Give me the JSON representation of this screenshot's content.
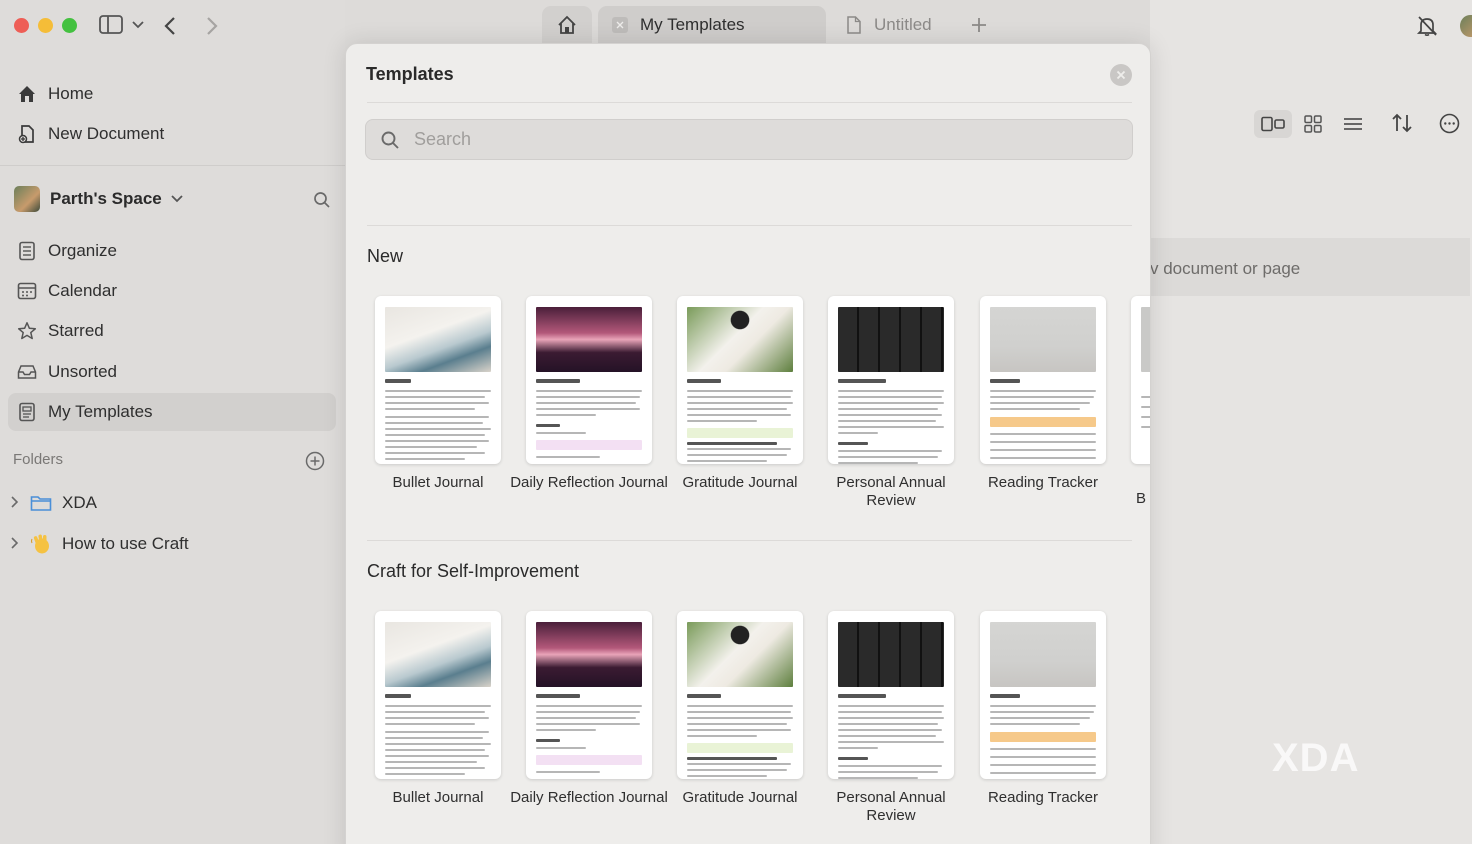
{
  "sidebar": {
    "nav": [
      {
        "label": "Home",
        "icon": "home-icon"
      },
      {
        "label": "New Document",
        "icon": "new-document-icon"
      }
    ],
    "space_name": "Parth's Space",
    "items": [
      {
        "label": "Organize",
        "icon": "organize-icon"
      },
      {
        "label": "Calendar",
        "icon": "calendar-icon"
      },
      {
        "label": "Starred",
        "icon": "star-icon"
      },
      {
        "label": "Unsorted",
        "icon": "inbox-icon"
      },
      {
        "label": "My Templates",
        "icon": "templates-icon"
      }
    ],
    "folders_label": "Folders",
    "folders": [
      {
        "label": "XDA",
        "icon": "folder-icon"
      },
      {
        "label": "How to use Craft",
        "icon": "waving-hand-icon"
      }
    ]
  },
  "tabs": {
    "active": "My Templates",
    "inactive": "Untitled"
  },
  "right": {
    "hint": "v document or page"
  },
  "modal": {
    "title": "Templates",
    "search_placeholder": "Search",
    "sections": [
      {
        "title": "New",
        "cards": [
          {
            "label": "Bullet Journal"
          },
          {
            "label": "Daily Reflection Journal"
          },
          {
            "label": "Gratitude Journal"
          },
          {
            "label": "Personal Annual Review"
          },
          {
            "label": "Reading Tracker"
          },
          {
            "label": "B"
          }
        ]
      },
      {
        "title": "Craft for Self-Improvement",
        "cards": [
          {
            "label": "Bullet Journal"
          },
          {
            "label": "Daily Reflection Journal"
          },
          {
            "label": "Gratitude Journal"
          },
          {
            "label": "Personal Annual Review"
          },
          {
            "label": "Reading Tracker"
          }
        ]
      }
    ]
  },
  "watermark": "XDA",
  "colors": {
    "traffic_red": "#ee5e56",
    "traffic_yellow": "#f5bd38",
    "traffic_green": "#44c140",
    "folder_blue": "#4a8fd8"
  }
}
